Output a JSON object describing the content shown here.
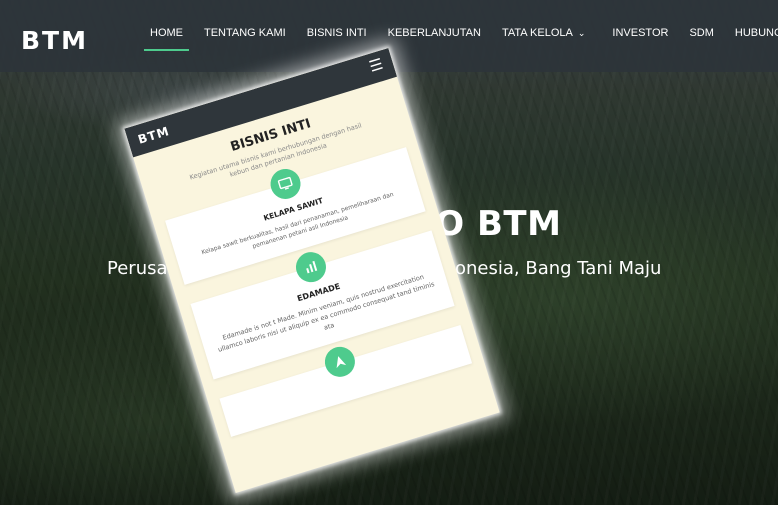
{
  "brand": "BTM",
  "nav": {
    "items": [
      {
        "label": "HOME",
        "active": true
      },
      {
        "label": "TENTANG KAMI"
      },
      {
        "label": "BISNIS INTI"
      },
      {
        "label": "KEBERLANJUTAN"
      },
      {
        "label": "TATA KELOLA",
        "dropdown": true
      },
      {
        "label": "INVESTOR"
      },
      {
        "label": "SDM"
      },
      {
        "label": "HUBUNGI KAMI"
      }
    ],
    "accent": "#4ecb8d"
  },
  "hero": {
    "title_visible": "TO BTM",
    "subtitle_left": "Perusahaan",
    "subtitle_right": "onesia, Bang Tani Maju"
  },
  "phone": {
    "brand": "BTM",
    "menu_icon": "hamburger-icon",
    "section_title": "BISNIS INTI",
    "section_intro": "Kegiatan utama bisnis kami berhubungan dengan hasil kebun dan pertanian Indonesia",
    "cards": [
      {
        "icon": "monitor-icon",
        "title": "KELAPA SAWIT",
        "text": "Kelapa sawit berkualitas, hasil dari penanaman, pemeliharaan dan pemanenan petani asli Indonesia"
      },
      {
        "icon": "chart-icon",
        "title": "EDAMADE",
        "text": "Edamade is not t Made. Minim veniam, quis nostrud exercitation ullamco laboris nisi ut aliquip ex ea commodo consequat tand timinis ata"
      },
      {
        "icon": "leaf-icon",
        "title": "",
        "text": ""
      }
    ],
    "accent": "#4ecb8d",
    "background": "#faf5de"
  }
}
